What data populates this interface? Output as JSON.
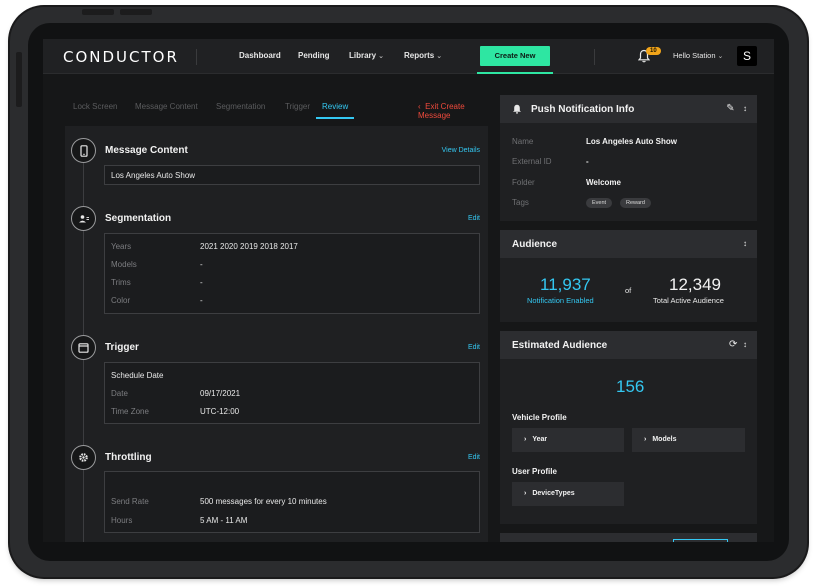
{
  "nav": {
    "logo": "CONDUCTOR",
    "links": [
      {
        "label": "Dashboard"
      },
      {
        "label": "Pending"
      },
      {
        "label": "Library",
        "dropdown": true
      },
      {
        "label": "Reports",
        "dropdown": true
      }
    ],
    "create_label": "Create New",
    "notification_count": "10",
    "user_label": "Hello Station",
    "avatar_initial": "S"
  },
  "steps": {
    "items": [
      "Lock Screen",
      "Message Content",
      "Segmentation",
      "Trigger",
      "Review"
    ],
    "active": "Review",
    "exit_label": "Exit Create Message"
  },
  "message_content": {
    "title": "Message Content",
    "link": "View Details",
    "value": "Los Angeles Auto Show"
  },
  "segmentation": {
    "title": "Segmentation",
    "link": "Edit",
    "rows": [
      {
        "label": "Years",
        "value": "2021 2020 2019 2018 2017"
      },
      {
        "label": "Models",
        "value": "-"
      },
      {
        "label": "Trims",
        "value": "-"
      },
      {
        "label": "Color",
        "value": "-"
      }
    ]
  },
  "trigger": {
    "title": "Trigger",
    "link": "Edit",
    "heading": "Schedule Date",
    "rows": [
      {
        "label": "Date",
        "value": "09/17/2021"
      },
      {
        "label": "Time Zone",
        "value": "UTC-12:00"
      }
    ]
  },
  "throttling": {
    "title": "Throttling",
    "link": "Edit",
    "rows": [
      {
        "label": "Send Rate",
        "value": "500 messages for every 10 minutes"
      },
      {
        "label": "Hours",
        "value": "5 AM - 11 AM"
      }
    ]
  },
  "push_info": {
    "title": "Push Notification Info",
    "rows": [
      {
        "label": "Name",
        "value": "Los Angeles Auto Show"
      },
      {
        "label": "External ID",
        "value": "-"
      },
      {
        "label": "Folder",
        "value": "Welcome"
      },
      {
        "label": "Tags",
        "value": ""
      }
    ],
    "tags": [
      "Event",
      "Reward"
    ]
  },
  "audience": {
    "title": "Audience",
    "enabled_count": "11,937",
    "enabled_label": "Notification Enabled",
    "of_label": "of",
    "total_count": "12,349",
    "total_label": "Total Active Audience"
  },
  "estimated": {
    "title": "Estimated Audience",
    "count": "156",
    "vehicle_title": "Vehicle Profile",
    "vehicle_buttons": [
      "Year",
      "Models"
    ],
    "user_title": "User Profile",
    "user_buttons": [
      "DeviceTypes"
    ]
  },
  "colors": {
    "accent_cyan": "#34c8f2",
    "accent_green": "#2ee6a2",
    "danger": "#ee4a3c",
    "badge": "#f2a51a"
  }
}
